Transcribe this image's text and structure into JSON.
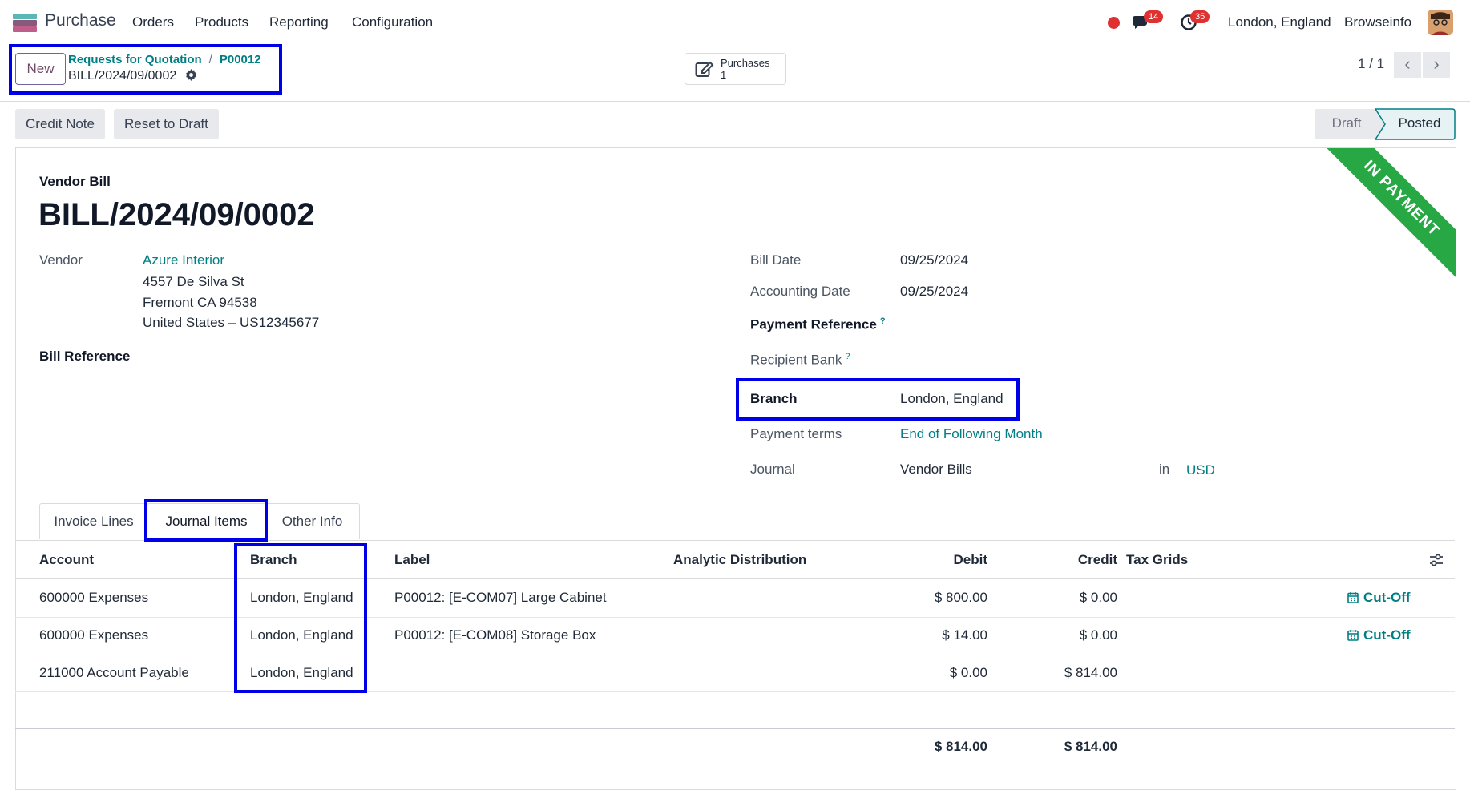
{
  "navbar": {
    "app_name": "Purchase",
    "menus": [
      "Orders",
      "Products",
      "Reporting",
      "Configuration"
    ],
    "messages_count": "14",
    "activities_count": "35",
    "company": "London, England",
    "user": "Browseinfo"
  },
  "control_panel": {
    "new_label": "New",
    "breadcrumb_root": "Requests for Quotation",
    "breadcrumb_parent": "P00012",
    "breadcrumb_current": "BILL/2024/09/0002",
    "smart_button_label": "Purchases",
    "smart_button_count": "1",
    "pager": "1 / 1"
  },
  "status": {
    "credit_note_label": "Credit Note",
    "reset_label": "Reset to Draft",
    "stages": [
      "Draft",
      "Posted"
    ],
    "active_stage": "Posted"
  },
  "form": {
    "ribbon": "IN PAYMENT",
    "doc_type": "Vendor Bill",
    "doc_name": "BILL/2024/09/0002",
    "vendor_label": "Vendor",
    "vendor_name": "Azure Interior",
    "vendor_address": [
      "4557 De Silva St",
      "Fremont CA 94538",
      "United States – US12345677"
    ],
    "bill_reference_label": "Bill Reference",
    "bill_date_label": "Bill Date",
    "bill_date": "09/25/2024",
    "accounting_date_label": "Accounting Date",
    "accounting_date": "09/25/2024",
    "payment_reference_label": "Payment Reference",
    "recipient_bank_label": "Recipient Bank",
    "branch_label": "Branch",
    "branch": "London, England",
    "payment_terms_label": "Payment terms",
    "payment_terms": "End of Following Month",
    "journal_label": "Journal",
    "journal": "Vendor Bills",
    "in_label": "in",
    "currency": "USD",
    "help_mark": "?"
  },
  "tabs": [
    "Invoice Lines",
    "Journal Items",
    "Other Info"
  ],
  "active_tab": "Journal Items",
  "table": {
    "headers": {
      "account": "Account",
      "branch": "Branch",
      "label": "Label",
      "analytic": "Analytic Distribution",
      "debit": "Debit",
      "credit": "Credit",
      "tax_grids": "Tax Grids"
    },
    "rows": [
      {
        "account": "600000 Expenses",
        "branch": "London, England",
        "label": "P00012: [E-COM07] Large Cabinet",
        "debit": "$ 800.00",
        "credit": "$ 0.00",
        "action": "Cut-Off"
      },
      {
        "account": "600000 Expenses",
        "branch": "London, England",
        "label": "P00012: [E-COM08] Storage Box",
        "debit": "$ 14.00",
        "credit": "$ 0.00",
        "action": "Cut-Off"
      },
      {
        "account": "211000 Account Payable",
        "branch": "London, England",
        "label": "",
        "debit": "$ 0.00",
        "credit": "$ 814.00",
        "action": ""
      }
    ],
    "total_debit": "$ 814.00",
    "total_credit": "$ 814.00"
  },
  "colors": {
    "brand": "#714b67",
    "link": "#017e84",
    "ribbon": "#28a745",
    "highlight": "#0000e6",
    "badge": "#e03131"
  }
}
